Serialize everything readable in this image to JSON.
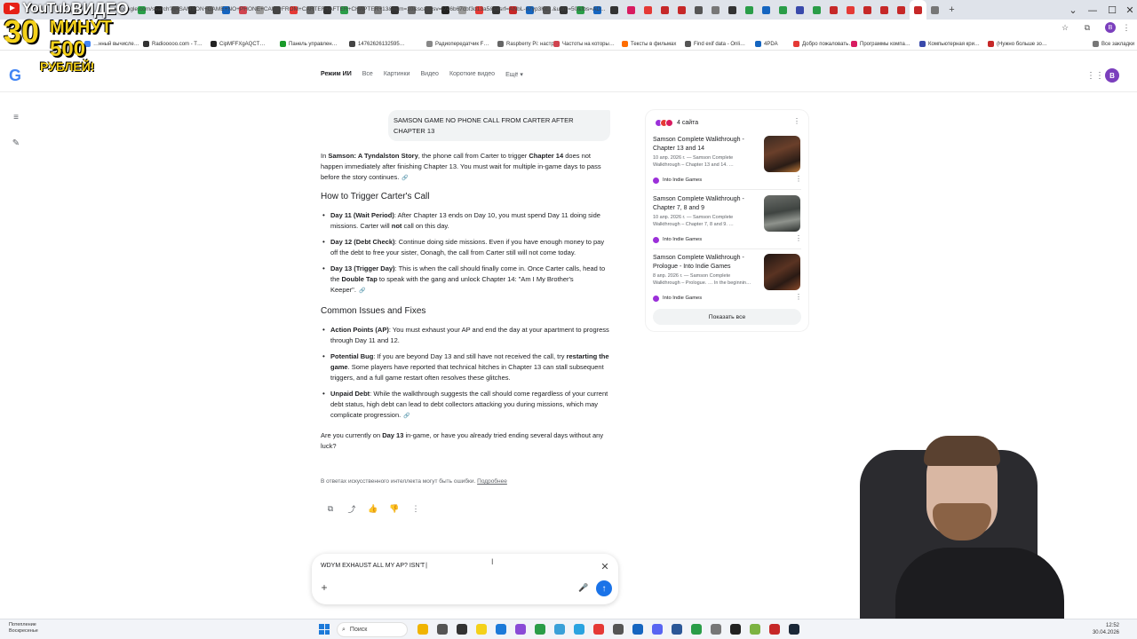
{
  "browser": {
    "url": "www.google.com/search?q=SAMSON+GAME+NO+PHONE+CALL+FROM+CARTER+AFTER+CHAPTER+13&num=10&sca_esv=f746b67cbf3d13a5&sxsrf=ANbL-n7yp3Kc...&udm=50&fbs=AD..."
  },
  "bookmarks": [
    {
      "label": "…нный вычисле…",
      "color": "#4285f4"
    },
    {
      "label": "Radiooooo.com - T…",
      "color": "#333333"
    },
    {
      "label": "CipMFFXgAQCT…",
      "color": "#222222"
    },
    {
      "label": "Панель управлен…",
      "color": "#1a9a2a"
    },
    {
      "label": "14762626132595…",
      "color": "#444444"
    },
    {
      "label": "Радиопередатчик F…",
      "color": "#888888"
    },
    {
      "label": "Raspberry Pi: настр…",
      "color": "#666666"
    },
    {
      "label": "Частоты на которы…",
      "color": "#d0444f"
    },
    {
      "label": "Тексты в фильмах",
      "color": "#ff6d00"
    },
    {
      "label": "Find exif data - Onli…",
      "color": "#555555"
    },
    {
      "label": "4PDA",
      "color": "#1565c0"
    },
    {
      "label": "Добро пожаловать…",
      "color": "#e53935"
    },
    {
      "label": "Программы компа…",
      "color": "#d81b60"
    },
    {
      "label": "Компьютерная кри…",
      "color": "#3949ab"
    },
    {
      "label": "(Нужно больше зо…",
      "color": "#c62828"
    },
    {
      "label": "Все закладки",
      "color": "#777777"
    }
  ],
  "promo": {
    "youtube": "YouTube",
    "video": "ВИДЕО",
    "num30": "30",
    "minutes": "МИНУТ",
    "num500": "500",
    "rubles": "РУБЛЕЙ!"
  },
  "nav": {
    "tabs": [
      "Режим ИИ",
      "Все",
      "Картинки",
      "Видео",
      "Короткие видео",
      "Ещё"
    ],
    "more_arrow": "▾",
    "avatar_letter": "B"
  },
  "conversation": {
    "query": "SAMSON GAME NO PHONE CALL FROM CARTER AFTER CHAPTER 13",
    "intro": {
      "pre": "In ",
      "game": "Samson: A Tyndalston Story",
      "mid": ", the phone call from Carter to trigger ",
      "chapter": "Chapter 14",
      "post": " does not happen immediately after finishing Chapter 13. You must wait for multiple in-game days to pass before the story continues."
    },
    "section1_title": "How to Trigger Carter's Call",
    "section1_items": [
      {
        "title": "Day 11 (Wait Period)",
        "text": ": After Chapter 13 ends on Day 10, you must spend Day 11 doing side missions. Carter will ",
        "bold2": "not",
        "text2": " call on this day."
      },
      {
        "title": "Day 12 (Debt Check)",
        "text": ": Continue doing side missions. Even if you have enough money to pay off the debt to free your sister, Oonagh, the call from Carter still will not come today.",
        "bold2": "",
        "text2": ""
      },
      {
        "title": "Day 13 (Trigger Day)",
        "text": ": This is when the call should finally come in. Once Carter calls, head to the ",
        "bold2": "Double Tap",
        "text2": " to speak with the gang and unlock Chapter 14: \"Am I My Brother's Keeper\"."
      }
    ],
    "section2_title": "Common Issues and Fixes",
    "section2_items": [
      {
        "title": "Action Points (AP)",
        "text": ": You must exhaust your AP and end the day at your apartment to progress through Day 11 and 12.",
        "bold2": "",
        "text2": ""
      },
      {
        "title": "Potential Bug",
        "text": ": If you are beyond Day 13 and still have not received the call, try ",
        "bold2": "restarting the game",
        "text2": ". Some players have reported that technical hitches in Chapter 13 can stall subsequent triggers, and a full game restart often resolves these glitches."
      },
      {
        "title": "Unpaid Debt",
        "text": ": While the walkthrough suggests the call should come regardless of your current debt status, high debt can lead to debt collectors attacking you during missions, which may complicate progression.",
        "bold2": "",
        "text2": ""
      }
    ],
    "question": {
      "pre": "Are you currently on ",
      "bold": "Day 13",
      "post": " in-game, or have you already tried ending several days without any luck?"
    },
    "disclaimer": "В ответах искусственного интеллекта могут быть ошибки.",
    "disclaimer_link": "Подробнее"
  },
  "sources": {
    "count_label": "4 сайта",
    "items": [
      {
        "title": "Samson Complete Walkthrough - Chapter 13 and 14",
        "snippet": "10 апр. 2026 г. — Samson Complete Walkthrough – Chapter 13 and 14. …",
        "site": "Into Indie Games"
      },
      {
        "title": "Samson Complete Walkthrough - Chapter 7, 8 and 9",
        "snippet": "10 апр. 2026 г. — Samson Complete Walkthrough – Chapter 7, 8 and 9. …",
        "site": "Into Indie Games"
      },
      {
        "title": "Samson Complete Walkthrough - Prologue - Into Indie Games",
        "snippet": "8 апр. 2026 г. — Samson Complete Walkthrough – Prologue. … In the beginnin…",
        "site": "Into Indie Games"
      }
    ],
    "show_all": "Показать все"
  },
  "composer": {
    "text": "WDYM EXHAUST ALL MY AP? ISN'T"
  },
  "taskbar": {
    "weather_line1": "Потепление",
    "weather_line2": "Воскресенье",
    "search_label": "Поиск",
    "time": "12:52",
    "date": "30.04.2026"
  },
  "colors": {
    "accent": "#1a73e8",
    "avatar": "#7b3fbd",
    "site_dot": "#9b30d9"
  }
}
